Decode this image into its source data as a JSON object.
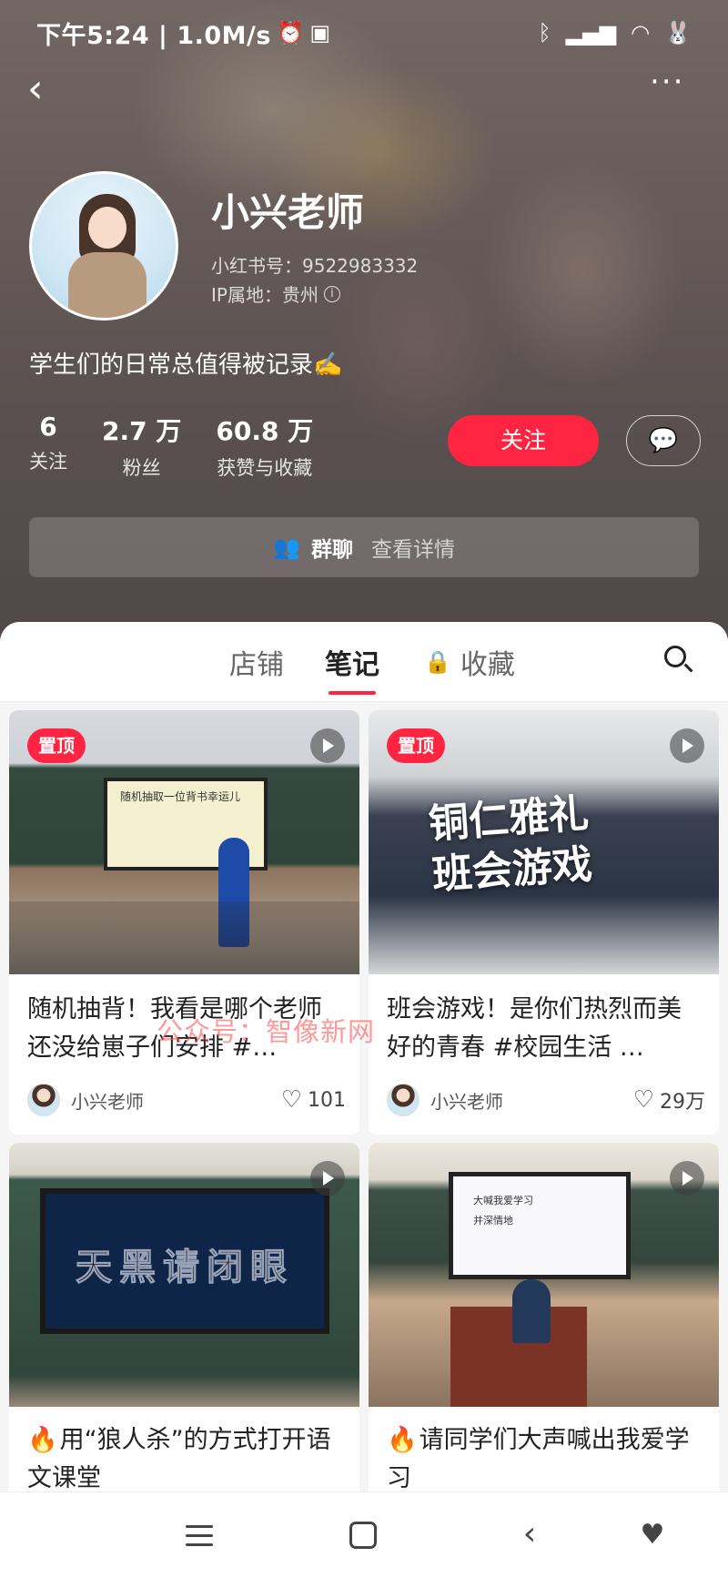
{
  "status_bar": {
    "time_speed": "下午5:24 | 1.0M/s",
    "icons": [
      "alarm-icon",
      "app-icon",
      "bluetooth-icon",
      "signal-icon",
      "wifi-icon",
      "rabbit-icon"
    ]
  },
  "profile": {
    "name": "小兴老师",
    "red_id": "小红书号：9522983332",
    "ip_location": "IP属地：贵州",
    "bio": "学生们的日常总值得被记录✍️",
    "stats": [
      {
        "value": "6",
        "label": "关注"
      },
      {
        "value": "2.7 万",
        "label": "粉丝"
      },
      {
        "value": "60.8 万",
        "label": "获赞与收藏"
      }
    ],
    "follow_label": "关注"
  },
  "group_chat": {
    "title": "群聊",
    "detail": "查看详情"
  },
  "tabs": {
    "shop": "店铺",
    "notes": "笔记",
    "favorites": "收藏",
    "active": "笔记"
  },
  "notes": [
    {
      "pinned_label": "置顶",
      "screen_title": "随机抽取一位背书幸运儿",
      "title": "随机抽背！我看是哪个老师还没给崽子们安排 #…",
      "author": "小兴老师",
      "likes": "101"
    },
    {
      "pinned_label": "置顶",
      "overlay_text": "铜仁雅礼\n班会游戏",
      "title": "班会游戏！是你们热烈而美好的青春 #校园生活 …",
      "author": "小兴老师",
      "likes": "29万"
    },
    {
      "board_text": "天黑请闭眼",
      "title": "用“狼人杀”的方式打开语文课堂"
    },
    {
      "screen_line1": "大喊我爱学习",
      "screen_line2": "并深情地",
      "title": "请同学们大声喊出我爱学习"
    }
  ],
  "watermark": "公众号：智像新网",
  "colors": {
    "accent": "#ff2442",
    "header_bg": "#7a6e6b",
    "content_bg": "#f5f5f5"
  }
}
